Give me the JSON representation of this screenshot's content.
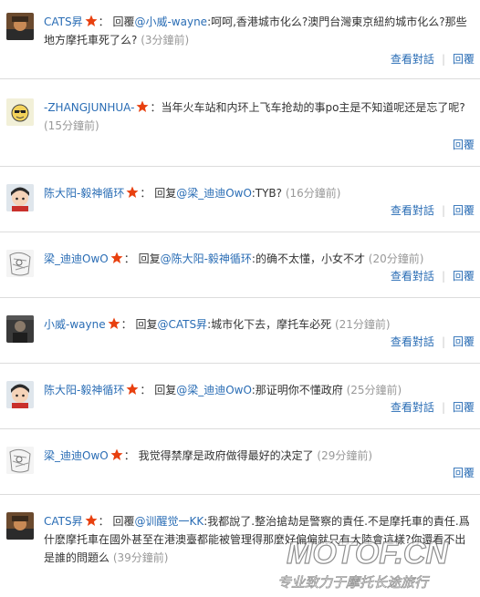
{
  "reply_word": "回覆",
  "reply_word_simplified": "回复",
  "colon": "：",
  "actions": {
    "view": "查看對話",
    "reply": "回覆",
    "separator": "|"
  },
  "colors": {
    "link": "#2a6db5",
    "time": "#999999",
    "star": "#e8400f",
    "divider": "#dcdcdc"
  },
  "comments": [
    {
      "user": "CATS昇",
      "mention": "@小威-wayne",
      "text": ":呵呵,香港城市化么?澳門台灣東京紐約城市化么?那些地方摩托車死了么?",
      "time": "(3分鐘前)",
      "avatar_icon": "avatar-cats-icon"
    },
    {
      "user": "-ZHANGJUNHUA-",
      "mention": "",
      "text": "当年火车站和内环上飞车抢劫的事po主是不知道呢还是忘了呢?",
      "time": "(15分鐘前)",
      "avatar_icon": "avatar-cartoon-icon"
    },
    {
      "user": "陈大阳-毅神循环",
      "mention": "@梁_迪迪OwO",
      "text": ":TYB?",
      "time": "(16分鐘前)",
      "avatar_icon": "avatar-boy-icon"
    },
    {
      "user": "梁_迪迪OwO",
      "mention": "@陈大阳-毅神循环",
      "text": ":的确不太懂，小女不才",
      "time": "(20分鐘前)",
      "avatar_icon": "avatar-sketch-icon"
    },
    {
      "user": "小威-wayne",
      "mention": "@CATS昇",
      "text": ":城市化下去，摩托车必死",
      "time": "(21分鐘前)",
      "avatar_icon": "avatar-dark-icon"
    },
    {
      "user": "陈大阳-毅神循环",
      "mention": "@梁_迪迪OwO",
      "text": ":那证明你不懂政府",
      "time": "(25分鐘前)",
      "avatar_icon": "avatar-boy-icon"
    },
    {
      "user": "梁_迪迪OwO",
      "mention": "",
      "text": "我觉得禁摩是政府做得最好的决定了",
      "time": "(29分鐘前)",
      "avatar_icon": "avatar-sketch-icon"
    },
    {
      "user": "CATS昇",
      "mention": "@训醒觉一KK",
      "text": ":我都說了.整治搶劫是警察的責任.不是摩托車的責任.爲什麽摩托車在國外甚至在港澳臺都能被管理得那麼好偏偏就只有大陸會這樣?你還看不出是誰的問題么",
      "time": "(39分鐘前)",
      "avatar_icon": "avatar-cats-icon"
    }
  ],
  "watermark": {
    "brand": "MOTOF.CN",
    "slogan": "专业致力于摩托长途旅行"
  }
}
